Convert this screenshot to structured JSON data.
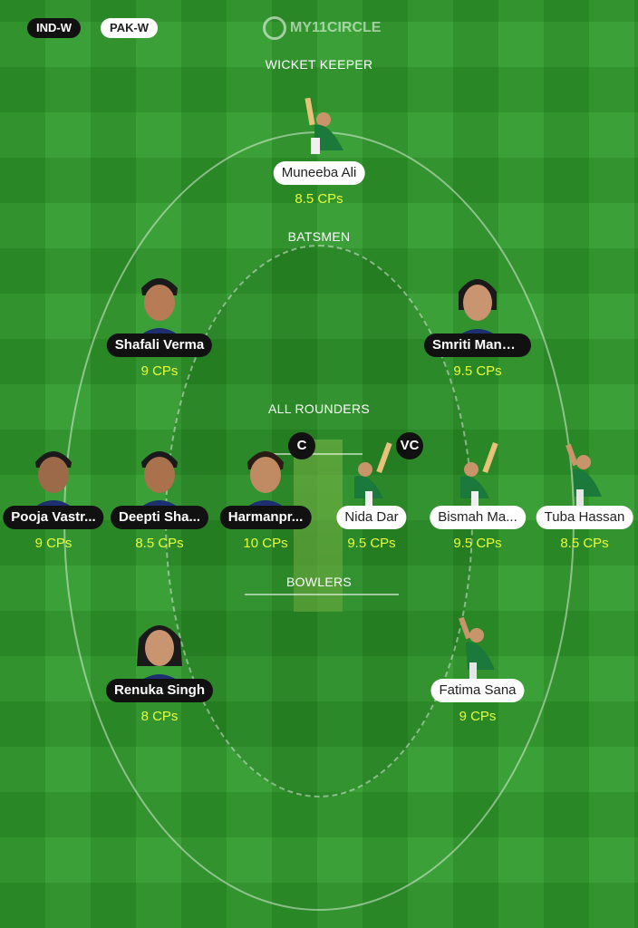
{
  "header": {
    "team1": "IND-W",
    "team2": "PAK-W",
    "logo_text": "MY11CIRCLE"
  },
  "sections": {
    "wicket_keeper": "WICKET KEEPER",
    "batsmen": "BATSMEN",
    "all_rounders": "ALL ROUNDERS",
    "bowlers": "BOWLERS"
  },
  "players": {
    "wk1": {
      "name": "Muneeba Ali",
      "credits": "8.5 CPs",
      "team": "PAK-W"
    },
    "bat1": {
      "name": "Shafali Verma",
      "credits": "9 CPs",
      "team": "IND-W"
    },
    "bat2": {
      "name": "Smriti Mandhana",
      "credits": "9.5 CPs",
      "team": "IND-W"
    },
    "ar1": {
      "name": "Pooja Vastr...",
      "credits": "9 CPs",
      "team": "IND-W"
    },
    "ar2": {
      "name": "Deepti Sha...",
      "credits": "8.5 CPs",
      "team": "IND-W"
    },
    "ar3": {
      "name": "Harmanpr...",
      "credits": "10 CPs",
      "team": "IND-W",
      "badge": "C"
    },
    "ar4": {
      "name": "Nida Dar",
      "credits": "9.5 CPs",
      "team": "PAK-W",
      "badge": "VC"
    },
    "ar5": {
      "name": "Bismah Ma...",
      "credits": "9.5 CPs",
      "team": "PAK-W"
    },
    "ar6": {
      "name": "Tuba Hassan",
      "credits": "8.5 CPs",
      "team": "PAK-W"
    },
    "bowl1": {
      "name": "Renuka Singh",
      "credits": "8 CPs",
      "team": "IND-W"
    },
    "bowl2": {
      "name": "Fatima Sana",
      "credits": "9 CPs",
      "team": "PAK-W"
    }
  },
  "colors": {
    "field": "#2f9a2b",
    "credits": "#e6ff3a",
    "ind_jersey": "#1d2f6f",
    "pak_jersey": "#1b7a3b"
  }
}
